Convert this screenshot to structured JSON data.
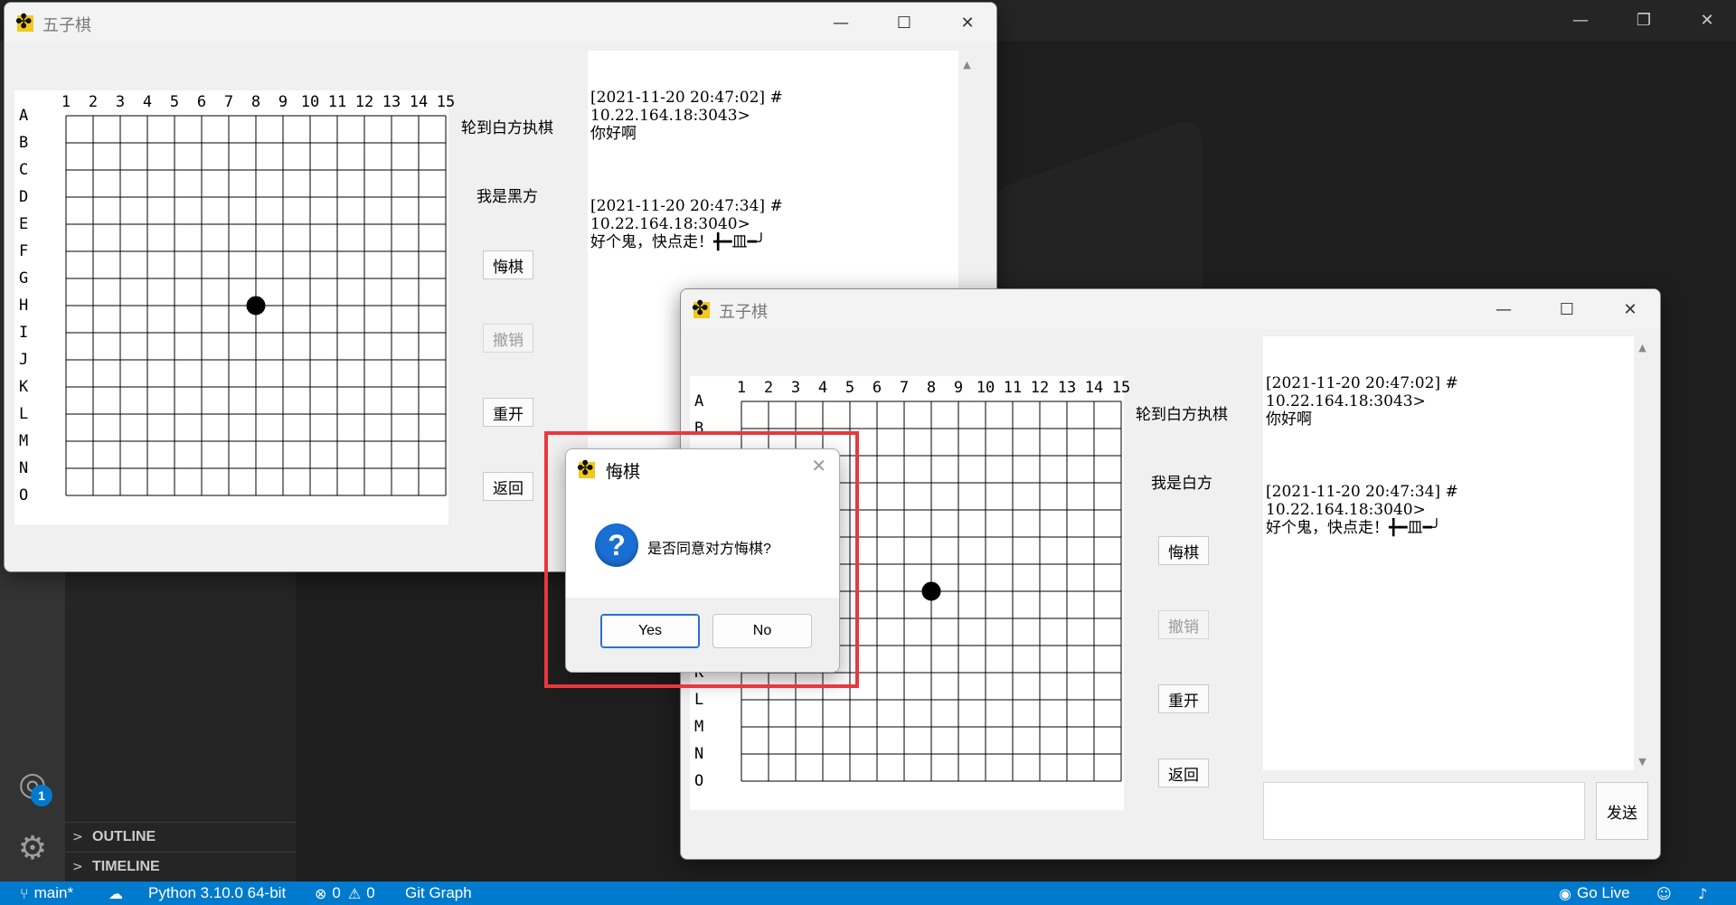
{
  "colors": {
    "vscode_statusbar": "#007acc",
    "highlight_box": "#e8383d",
    "board_line": "#000000"
  },
  "vscode": {
    "window_controls": [
      "minimize-icon",
      "restore-icon",
      "close-icon"
    ],
    "sections": {
      "outline": "OUTLINE",
      "timeline": "TIMELINE"
    },
    "account_badge": "1",
    "statusbar": {
      "branch": "main*",
      "python": "Python 3.10.0 64-bit",
      "errors": "0",
      "warnings": "0",
      "git_graph": "Git Graph",
      "go_live": "Go Live"
    }
  },
  "board": {
    "columns": [
      "1",
      "2",
      "3",
      "4",
      "5",
      "6",
      "7",
      "8",
      "9",
      "10",
      "11",
      "12",
      "13",
      "14",
      "15"
    ],
    "rows": [
      "A",
      "B",
      "C",
      "D",
      "E",
      "F",
      "G",
      "H",
      "I",
      "J",
      "K",
      "L",
      "M",
      "N",
      "O"
    ],
    "stones": [
      {
        "row": "H",
        "col": "8",
        "color": "black"
      }
    ]
  },
  "window_black": {
    "title": "五子棋",
    "turn_label": "轮到白方执棋",
    "role_label": "我是黑方",
    "buttons": {
      "undo_request": "悔棋",
      "undo_cancel": "撤销",
      "restart": "重开",
      "back": "返回"
    },
    "undo_cancel_disabled": true
  },
  "window_white": {
    "title": "五子棋",
    "turn_label": "轮到白方执棋",
    "role_label": "我是白方",
    "buttons": {
      "undo_request": "悔棋",
      "undo_cancel": "撤销",
      "restart": "重开",
      "back": "返回"
    },
    "undo_cancel_disabled": true,
    "send_label": "发送",
    "input_value": ""
  },
  "chat": [
    {
      "header1": "[2021-11-20 20:47:02] #",
      "header2": "10.22.164.18:3043>",
      "text": "你好啊"
    },
    {
      "header1": "[2021-11-20 20:47:34] #",
      "header2": "10.22.164.18:3040>",
      "text": "好个鬼，快点走！╋━皿━╯"
    }
  ],
  "dialog": {
    "title": "悔棋",
    "icon": "question-icon",
    "message": "是否同意对方悔棋?",
    "yes_label": "Yes",
    "no_label": "No"
  }
}
